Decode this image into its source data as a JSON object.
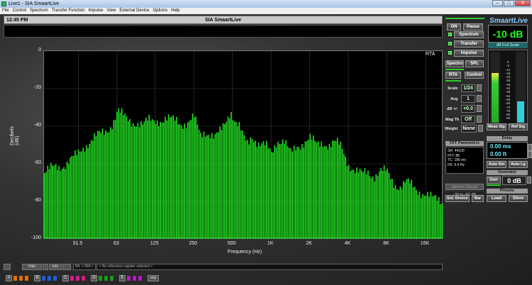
{
  "window": {
    "title": "Live1 - SIA SmaartLive",
    "buttons": [
      "–",
      "□",
      "X"
    ]
  },
  "menu": [
    "File",
    "Control",
    "Spectrum",
    "Transfer Function",
    "Impulse",
    "View",
    "External Device",
    "Options",
    "Help"
  ],
  "header": {
    "time": "12:45 PM",
    "title": "SIA SmaartLive"
  },
  "plot": {
    "mode_label": "RTA"
  },
  "bottom": {
    "buttons": [
      "",
      "Hide",
      "",
      "Info",
      ""
    ],
    "wt": "Wt: < N/A >",
    "ref_placeholder": "< No reference register selected >",
    "registers": [
      {
        "letter": "A",
        "colors": [
          "#e07000",
          "#e07000",
          "#e07000"
        ]
      },
      {
        "letter": "B",
        "colors": [
          "#1e5fd0",
          "#1e5fd0",
          "#1e5fd0"
        ]
      },
      {
        "letter": "C",
        "colors": [
          "#d0208a",
          "#d0208a",
          "#d0208a"
        ]
      },
      {
        "letter": "D",
        "colors": [
          "#1a9a1a",
          "#1a9a1a",
          "#1a9a1a"
        ]
      },
      {
        "letter": "E",
        "colors": [
          "#b01ec0",
          "#b01ec0",
          "#b01ec0"
        ]
      }
    ],
    "avg_label": "avg"
  },
  "panel": {
    "logo": "SmaartLive",
    "on": "ON",
    "pause": "Pause",
    "modes": [
      "Spectrum",
      "Transfer",
      "Impulse"
    ],
    "level": "-10 dB",
    "level_caption": "dB Full Scale",
    "spectro": "Spectro",
    "spl": "SPL",
    "rta": "RTA",
    "control": "Control",
    "scale_label": "Scale",
    "scale": "1/24",
    "avg_label": "Avg",
    "avg": "1",
    "db_label": "dB +/-",
    "db": "+0.0",
    "magth_label": "Mag Th",
    "magth": "Off",
    "weight_label": "Weight",
    "weight": "None",
    "meter_ticks": [
      "0",
      "-6",
      "-12",
      "-18",
      "-24",
      "-30",
      "-36",
      "-42",
      "-48",
      "-54",
      "-60",
      "-66",
      "-72",
      "-78",
      "-84",
      "-90"
    ],
    "meas_sig": "Meas Sig",
    "ref_sig": "Ref Sig",
    "fft_title": "FFT Parameters",
    "fft": [
      "SR: 44100",
      "FFT: 8K",
      "TC: 186 ms",
      "FR: 5.4 Hz"
    ],
    "delay_title": "Delay",
    "delay_ms": "0.00 ms",
    "delay_ft": "0.00 ft",
    "auto_sm": "Auto Sm",
    "auto_lg": "Auto Lg",
    "spectro_range": "Spectro Range",
    "range_value": "-30 to -66 dB",
    "generator_title": "Generator",
    "gen": "Gen",
    "gen_level": "0 dB",
    "ext_device": "Ext. Device",
    "bar": "Bar",
    "presets_title": "Presets",
    "load": "Load",
    "store": "Store"
  },
  "chart_data": {
    "type": "bar",
    "xlabel": "Frequency (Hz)",
    "ylabel": "Decibels (dB)",
    "ylim": [
      -100,
      0
    ],
    "xscale": "log",
    "xlim": [
      17,
      22000
    ],
    "x_ticks": [
      "31.5",
      "63",
      "125",
      "250",
      "500",
      "1K",
      "2K",
      "4K",
      "8K",
      "16K"
    ],
    "y_ticks": [
      "0",
      "-20",
      "-40",
      "-60",
      "-80",
      "-100"
    ],
    "grid": true,
    "color": "#22e622",
    "spectrum": [
      [
        17,
        -65
      ],
      [
        20,
        -62
      ],
      [
        25,
        -60
      ],
      [
        30,
        -56
      ],
      [
        35,
        -50
      ],
      [
        40,
        -47
      ],
      [
        45,
        -45
      ],
      [
        50,
        -43
      ],
      [
        55,
        -40
      ],
      [
        60,
        -36
      ],
      [
        63,
        -32
      ],
      [
        70,
        -35
      ],
      [
        80,
        -37
      ],
      [
        90,
        -38
      ],
      [
        100,
        -40
      ],
      [
        110,
        -37
      ],
      [
        125,
        -36
      ],
      [
        140,
        -37
      ],
      [
        160,
        -37
      ],
      [
        180,
        -36
      ],
      [
        200,
        -38
      ],
      [
        220,
        -39
      ],
      [
        250,
        -36
      ],
      [
        280,
        -44
      ],
      [
        300,
        -42
      ],
      [
        330,
        -44
      ],
      [
        360,
        -47
      ],
      [
        400,
        -43
      ],
      [
        450,
        -35
      ],
      [
        480,
        -31
      ],
      [
        520,
        -38
      ],
      [
        560,
        -41
      ],
      [
        600,
        -46
      ],
      [
        650,
        -49
      ],
      [
        700,
        -44
      ],
      [
        800,
        -50
      ],
      [
        900,
        -51
      ],
      [
        1000,
        -54
      ],
      [
        1100,
        -47
      ],
      [
        1250,
        -48
      ],
      [
        1400,
        -55
      ],
      [
        1600,
        -50
      ],
      [
        1800,
        -48
      ],
      [
        2000,
        -47
      ],
      [
        2250,
        -50
      ],
      [
        2500,
        -48
      ],
      [
        2800,
        -50
      ],
      [
        3150,
        -49
      ],
      [
        3500,
        -51
      ],
      [
        4000,
        -60
      ],
      [
        4500,
        -64
      ],
      [
        5000,
        -66
      ],
      [
        5600,
        -64
      ],
      [
        6300,
        -66
      ],
      [
        7100,
        -64
      ],
      [
        8000,
        -65
      ],
      [
        9000,
        -70
      ],
      [
        10000,
        -72
      ],
      [
        11200,
        -70
      ],
      [
        12500,
        -72
      ],
      [
        14000,
        -74
      ],
      [
        16000,
        -76
      ],
      [
        18000,
        -79
      ],
      [
        20000,
        -79
      ],
      [
        22000,
        -80
      ]
    ]
  }
}
